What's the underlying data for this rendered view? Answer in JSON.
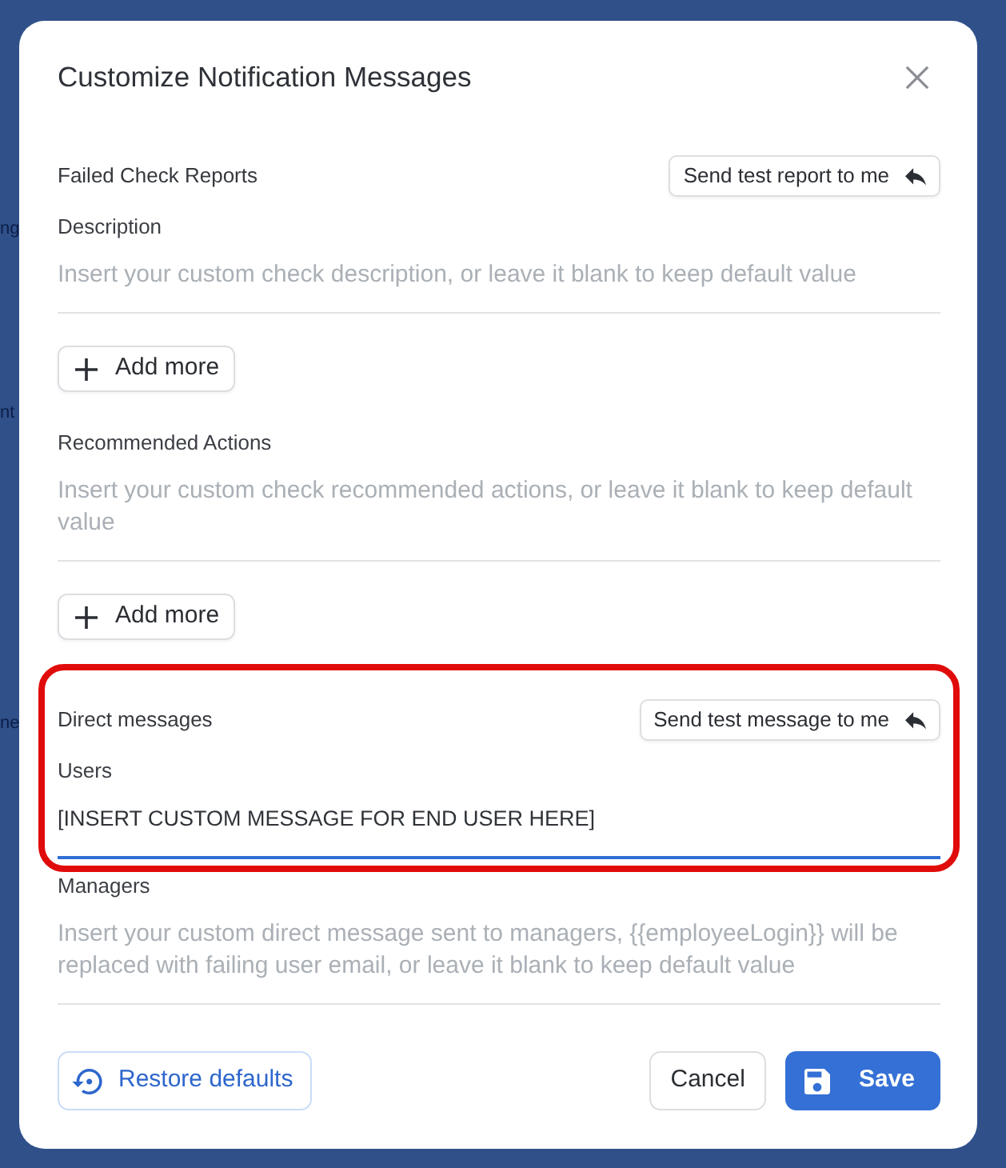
{
  "background": {
    "texts": [
      "ng",
      "nt",
      "ne"
    ]
  },
  "dialog": {
    "title": "Customize Notification Messages"
  },
  "sections": [
    {
      "title": "Failed Check Reports",
      "test_button": "Send test report to me",
      "highlighted": false,
      "fields": [
        {
          "label": "Description",
          "placeholder": "Insert your custom check description, or leave it blank to keep default value",
          "focused": false,
          "highlighted": false,
          "add_button": "Add more"
        },
        {
          "label": "Recommended Actions",
          "placeholder": "Insert your custom check recommended actions, or leave it blank to keep default value",
          "focused": false,
          "highlighted": false,
          "add_button": "Add more"
        }
      ]
    },
    {
      "title": "Direct messages",
      "test_button": "Send test message to me",
      "highlighted": true,
      "fields": [
        {
          "label": "Users",
          "value": "[INSERT CUSTOM MESSAGE FOR END USER HERE]",
          "focused": true,
          "highlighted": true
        },
        {
          "label": "Managers",
          "placeholder": "Insert your custom direct message sent to managers, {{employeeLogin}} will be replaced with failing user email, or leave it blank to keep default value",
          "focused": false,
          "highlighted": false
        }
      ]
    }
  ],
  "footer": {
    "restore_button": "Restore defaults",
    "cancel_button": "Cancel",
    "save_button": "Save"
  }
}
